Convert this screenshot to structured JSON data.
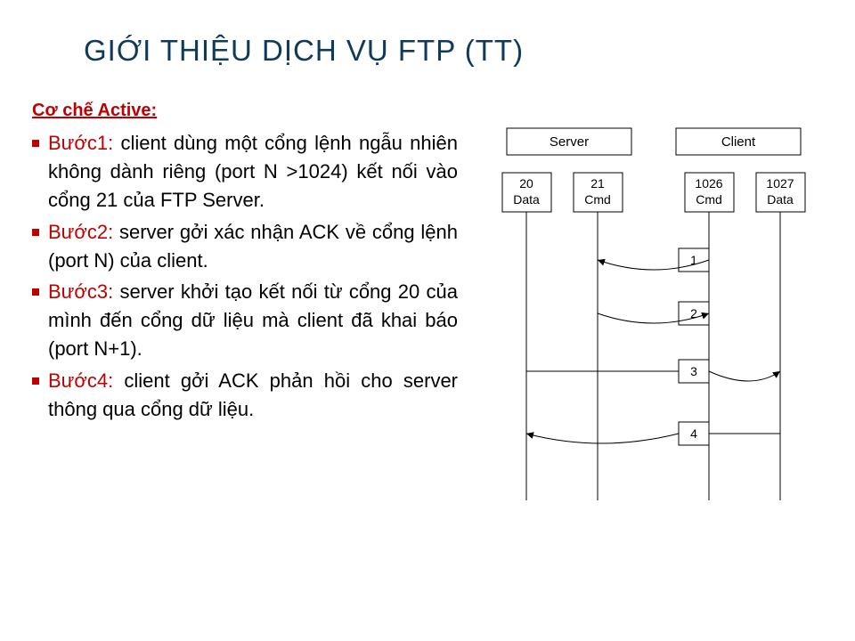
{
  "title": "GIỚI THIỆU DỊCH VỤ FTP (TT)",
  "heading": "Cơ chế Active:",
  "steps": [
    {
      "label": "Bước1:",
      "text": " client dùng một cổng lệnh ngẫu nhiên không dành riêng (port N >1024) kết nối vào cổng 21 của FTP Server."
    },
    {
      "label": "Bước2:",
      "text": " server gởi xác nhận ACK về cổng lệnh (port N) của client."
    },
    {
      "label": "Bước3:",
      "text": " server khởi tạo kết nối từ cổng 20 của mình đến cổng dữ liệu mà client đã khai báo (port N+1)."
    },
    {
      "label": "Bước4:",
      "text": " client gởi ACK phản hồi cho server thông qua cổng dữ liệu."
    }
  ],
  "diagram": {
    "server_label": "Server",
    "client_label": "Client",
    "ports": [
      {
        "num": "20",
        "role": "Data"
      },
      {
        "num": "21",
        "role": "Cmd"
      },
      {
        "num": "1026",
        "role": "Cmd"
      },
      {
        "num": "1027",
        "role": "Data"
      }
    ],
    "msgs": [
      "1",
      "2",
      "3",
      "4"
    ]
  }
}
